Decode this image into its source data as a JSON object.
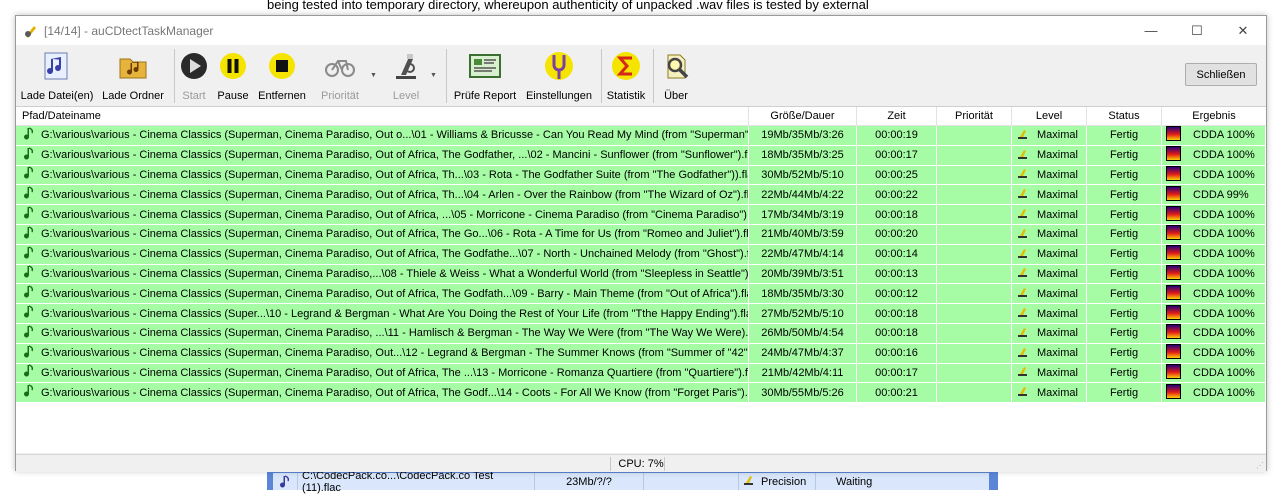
{
  "background": {
    "text": "being tested into temporary directory, whereupon authenticity of unpacked .wav files is tested by external",
    "row": {
      "path": "C:\\CodecPack.co...\\CodecPack.co Test (11).flac",
      "size": "23Mb/?/?",
      "level": "Precision",
      "status": "Waiting"
    }
  },
  "window": {
    "title": "[14/14] - auCDtectTaskManager",
    "controls": {
      "minimize": "—",
      "maximize": "☐",
      "close": "✕"
    }
  },
  "toolbar": {
    "load_files": "Lade Datei(en)",
    "load_folder": "Lade Ordner",
    "start": "Start",
    "pause": "Pause",
    "remove": "Entfernen",
    "priority": "Priorität",
    "level": "Level",
    "check_report": "Prüfe Report",
    "settings": "Einstellungen",
    "statistics": "Statistik",
    "about": "Über",
    "close": "Schließen"
  },
  "columns": {
    "path": "Pfad/Dateiname",
    "size": "Größe/Dauer",
    "time": "Zeit",
    "priority": "Priorität",
    "level": "Level",
    "status": "Status",
    "result": "Ergebnis"
  },
  "rows": [
    {
      "path": "G:\\various\\various - Cinema Classics (Superman, Cinema Paradiso, Out o...\\01 - Williams & Bricusse - Can You Read My Mind (from \"Superman\").flac",
      "size": "19Mb/35Mb/3:26",
      "time": "00:00:19",
      "priority": "",
      "level": "Maximal",
      "status": "Fertig",
      "result": "CDDA 100%"
    },
    {
      "path": "G:\\various\\various - Cinema Classics (Superman, Cinema Paradiso, Out of Africa, The Godfather, ...\\02 - Mancini - Sunflower (from \"Sunflower\").flac",
      "size": "18Mb/35Mb/3:25",
      "time": "00:00:17",
      "priority": "",
      "level": "Maximal",
      "status": "Fertig",
      "result": "CDDA 100%"
    },
    {
      "path": "G:\\various\\various - Cinema Classics (Superman, Cinema Paradiso, Out of Africa, Th...\\03 - Rota - The Godfather Suite (from \"The Godfather\")).flac",
      "size": "30Mb/52Mb/5:10",
      "time": "00:00:25",
      "priority": "",
      "level": "Maximal",
      "status": "Fertig",
      "result": "CDDA 100%"
    },
    {
      "path": "G:\\various\\various - Cinema Classics (Superman, Cinema Paradiso, Out of Africa, Th...\\04 - Arlen - Over the Rainbow (from \"The Wizard of Oz\").flac",
      "size": "22Mb/44Mb/4:22",
      "time": "00:00:22",
      "priority": "",
      "level": "Maximal",
      "status": "Fertig",
      "result": "CDDA 99%"
    },
    {
      "path": "G:\\various\\various - Cinema Classics (Superman, Cinema Paradiso, Out of Africa, ...\\05 - Morricone - Cinema Paradiso (from \"Cinema Paradiso\").flac",
      "size": "17Mb/34Mb/3:19",
      "time": "00:00:18",
      "priority": "",
      "level": "Maximal",
      "status": "Fertig",
      "result": "CDDA 100%"
    },
    {
      "path": "G:\\various\\various - Cinema Classics (Superman, Cinema Paradiso, Out of Africa, The Go...\\06 - Rota - A Time for Us (from \"Romeo and Juliet\").flac",
      "size": "21Mb/40Mb/3:59",
      "time": "00:00:20",
      "priority": "",
      "level": "Maximal",
      "status": "Fertig",
      "result": "CDDA 100%"
    },
    {
      "path": "G:\\various\\various - Cinema Classics (Superman, Cinema Paradiso, Out of Africa, The Godfathe...\\07 - North - Unchained Melody (from \"Ghost\").flac",
      "size": "22Mb/47Mb/4:14",
      "time": "00:00:14",
      "priority": "",
      "level": "Maximal",
      "status": "Fertig",
      "result": "CDDA 100%"
    },
    {
      "path": "G:\\various\\various - Cinema Classics (Superman, Cinema Paradiso,...\\08 - Thiele & Weiss - What a Wonderful World (from \"Sleepless in Seattle\").flac",
      "size": "20Mb/39Mb/3:51",
      "time": "00:00:13",
      "priority": "",
      "level": "Maximal",
      "status": "Fertig",
      "result": "CDDA 100%"
    },
    {
      "path": "G:\\various\\various - Cinema Classics (Superman, Cinema Paradiso, Out of Africa, The Godfath...\\09 - Barry - Main Theme (from \"Out of Africa\").flac",
      "size": "18Mb/35Mb/3:30",
      "time": "00:00:12",
      "priority": "",
      "level": "Maximal",
      "status": "Fertig",
      "result": "CDDA 100%"
    },
    {
      "path": "G:\\various\\various - Cinema Classics (Super...\\10 - Legrand & Bergman - What Are You Doing the Rest of Your Life (from \"Tthe Happy Ending\").flac",
      "size": "27Mb/52Mb/5:10",
      "time": "00:00:18",
      "priority": "",
      "level": "Maximal",
      "status": "Fertig",
      "result": "CDDA 100%"
    },
    {
      "path": "G:\\various\\various - Cinema Classics (Superman, Cinema Paradiso, ...\\11 - Hamlisch & Bergman - The Way We Were (from \"The Way We Were).flac",
      "size": "26Mb/50Mb/4:54",
      "time": "00:00:18",
      "priority": "",
      "level": "Maximal",
      "status": "Fertig",
      "result": "CDDA 100%"
    },
    {
      "path": "G:\\various\\various - Cinema Classics (Superman, Cinema Paradiso, Out...\\12 - Legrand & Bergman - The Summer Knows (from \"Summer of \"42\").flac",
      "size": "24Mb/47Mb/4:37",
      "time": "00:00:16",
      "priority": "",
      "level": "Maximal",
      "status": "Fertig",
      "result": "CDDA 100%"
    },
    {
      "path": "G:\\various\\various - Cinema Classics (Superman, Cinema Paradiso, Out of Africa, The ...\\13 - Morricone - Romanza Quartiere (from \"Quartiere\").flac",
      "size": "21Mb/42Mb/4:11",
      "time": "00:00:17",
      "priority": "",
      "level": "Maximal",
      "status": "Fertig",
      "result": "CDDA 100%"
    },
    {
      "path": "G:\\various\\various - Cinema Classics (Superman, Cinema Paradiso, Out of Africa, The Godf...\\14 - Coots - For All We Know (from \"Forget Paris\").flac",
      "size": "30Mb/55Mb/5:26",
      "time": "00:00:21",
      "priority": "",
      "level": "Maximal",
      "status": "Fertig",
      "result": "CDDA 100%"
    }
  ],
  "status_bar": {
    "cpu": "CPU: 7%"
  },
  "colors": {
    "row_done": "#a5fca5",
    "window_bg": "#f0f0f0",
    "bg_window": "#5b86d8"
  }
}
